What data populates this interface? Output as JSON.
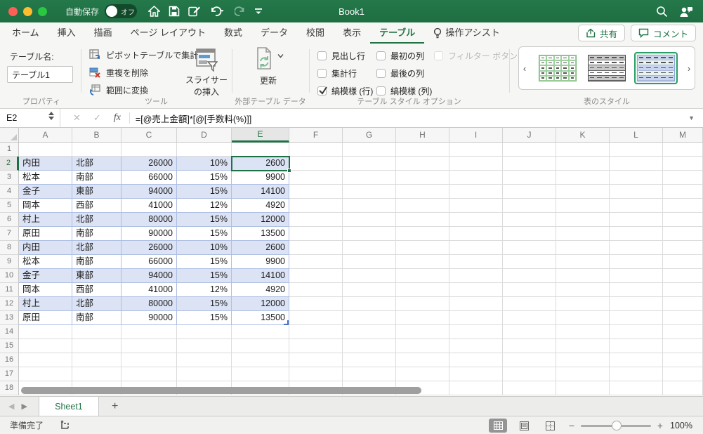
{
  "titlebar": {
    "autosave_label": "自動保存",
    "autosave_state": "オフ",
    "title": "Book1"
  },
  "tabbar": {
    "tabs": [
      {
        "label": "ホーム",
        "active": false
      },
      {
        "label": "挿入",
        "active": false
      },
      {
        "label": "描画",
        "active": false
      },
      {
        "label": "ページ レイアウト",
        "active": false
      },
      {
        "label": "数式",
        "active": false
      },
      {
        "label": "データ",
        "active": false
      },
      {
        "label": "校閲",
        "active": false
      },
      {
        "label": "表示",
        "active": false
      },
      {
        "label": "テーブル",
        "active": true
      },
      {
        "label": "操作アシスト",
        "active": false,
        "icon": "lightbulb"
      }
    ],
    "share_label": "共有",
    "comments_label": "コメント"
  },
  "ribbon": {
    "table_name_label": "テーブル名:",
    "table_name_value": "テーブル1",
    "tools": [
      "ピボットテーブルで集計",
      "重複を削除",
      "範囲に変換"
    ],
    "slicer_line1": "スライサー",
    "slicer_line2": "の挿入",
    "refresh_label": "更新",
    "checkbox_columns": [
      [
        {
          "label": "見出し行",
          "checked": false,
          "disabled": false
        },
        {
          "label": "集計行",
          "checked": false,
          "disabled": false
        },
        {
          "label": "縞模様 (行)",
          "checked": true,
          "disabled": false
        }
      ],
      [
        {
          "label": "最初の列",
          "checked": false,
          "disabled": false
        },
        {
          "label": "最後の列",
          "checked": false,
          "disabled": false
        },
        {
          "label": "縞模様 (列)",
          "checked": false,
          "disabled": false
        }
      ],
      [
        {
          "label": "フィルター ボタン",
          "checked": false,
          "disabled": true
        }
      ]
    ],
    "style_gallery": [
      {
        "name": "table-style-green",
        "kind": "green",
        "selected": false
      },
      {
        "name": "table-style-dark",
        "kind": "dark",
        "selected": false
      },
      {
        "name": "table-style-blue",
        "kind": "blue",
        "selected": true
      }
    ],
    "captions": {
      "properties": "プロパティ",
      "tools": "ツール",
      "external": "外部テーブル データ",
      "style_options": "テーブル スタイル オプション",
      "styles": "表のスタイル"
    }
  },
  "formulabar": {
    "name_box": "E2",
    "fx_label": "fx",
    "formula": "=[@売上金額]*[@[手数料(%)]]"
  },
  "grid": {
    "columns": [
      "A",
      "B",
      "C",
      "D",
      "E",
      "F",
      "G",
      "H",
      "I",
      "J",
      "K",
      "L",
      "M"
    ],
    "row_count": 18,
    "selected_column": "E",
    "selected_row": 2,
    "selected_cell": "E2",
    "table": {
      "first_row": 2,
      "last_row": 13,
      "rows": [
        {
          "row": 2,
          "cells": [
            "内田",
            "北部",
            "26000",
            "10%",
            "2600"
          ]
        },
        {
          "row": 3,
          "cells": [
            "松本",
            "南部",
            "66000",
            "15%",
            "9900"
          ]
        },
        {
          "row": 4,
          "cells": [
            "金子",
            "東部",
            "94000",
            "15%",
            "14100"
          ]
        },
        {
          "row": 5,
          "cells": [
            "岡本",
            "西部",
            "41000",
            "12%",
            "4920"
          ]
        },
        {
          "row": 6,
          "cells": [
            "村上",
            "北部",
            "80000",
            "15%",
            "12000"
          ]
        },
        {
          "row": 7,
          "cells": [
            "原田",
            "南部",
            "90000",
            "15%",
            "13500"
          ]
        },
        {
          "row": 8,
          "cells": [
            "内田",
            "北部",
            "26000",
            "10%",
            "2600"
          ]
        },
        {
          "row": 9,
          "cells": [
            "松本",
            "南部",
            "66000",
            "15%",
            "9900"
          ]
        },
        {
          "row": 10,
          "cells": [
            "金子",
            "東部",
            "94000",
            "15%",
            "14100"
          ]
        },
        {
          "row": 11,
          "cells": [
            "岡本",
            "西部",
            "41000",
            "12%",
            "4920"
          ]
        },
        {
          "row": 12,
          "cells": [
            "村上",
            "北部",
            "80000",
            "15%",
            "12000"
          ]
        },
        {
          "row": 13,
          "cells": [
            "原田",
            "南部",
            "90000",
            "15%",
            "13500"
          ]
        }
      ]
    }
  },
  "sheetbar": {
    "sheets": [
      {
        "name": "Sheet1",
        "active": true
      }
    ]
  },
  "statusbar": {
    "ready_label": "準備完了",
    "zoom_label": "100%"
  },
  "colors": {
    "accent_green": "#217346",
    "selection_green": "#1e7145",
    "banded_row": "#dce3f5",
    "table_border": "#aebfe3",
    "titlebar_green": "#1f6e43"
  }
}
